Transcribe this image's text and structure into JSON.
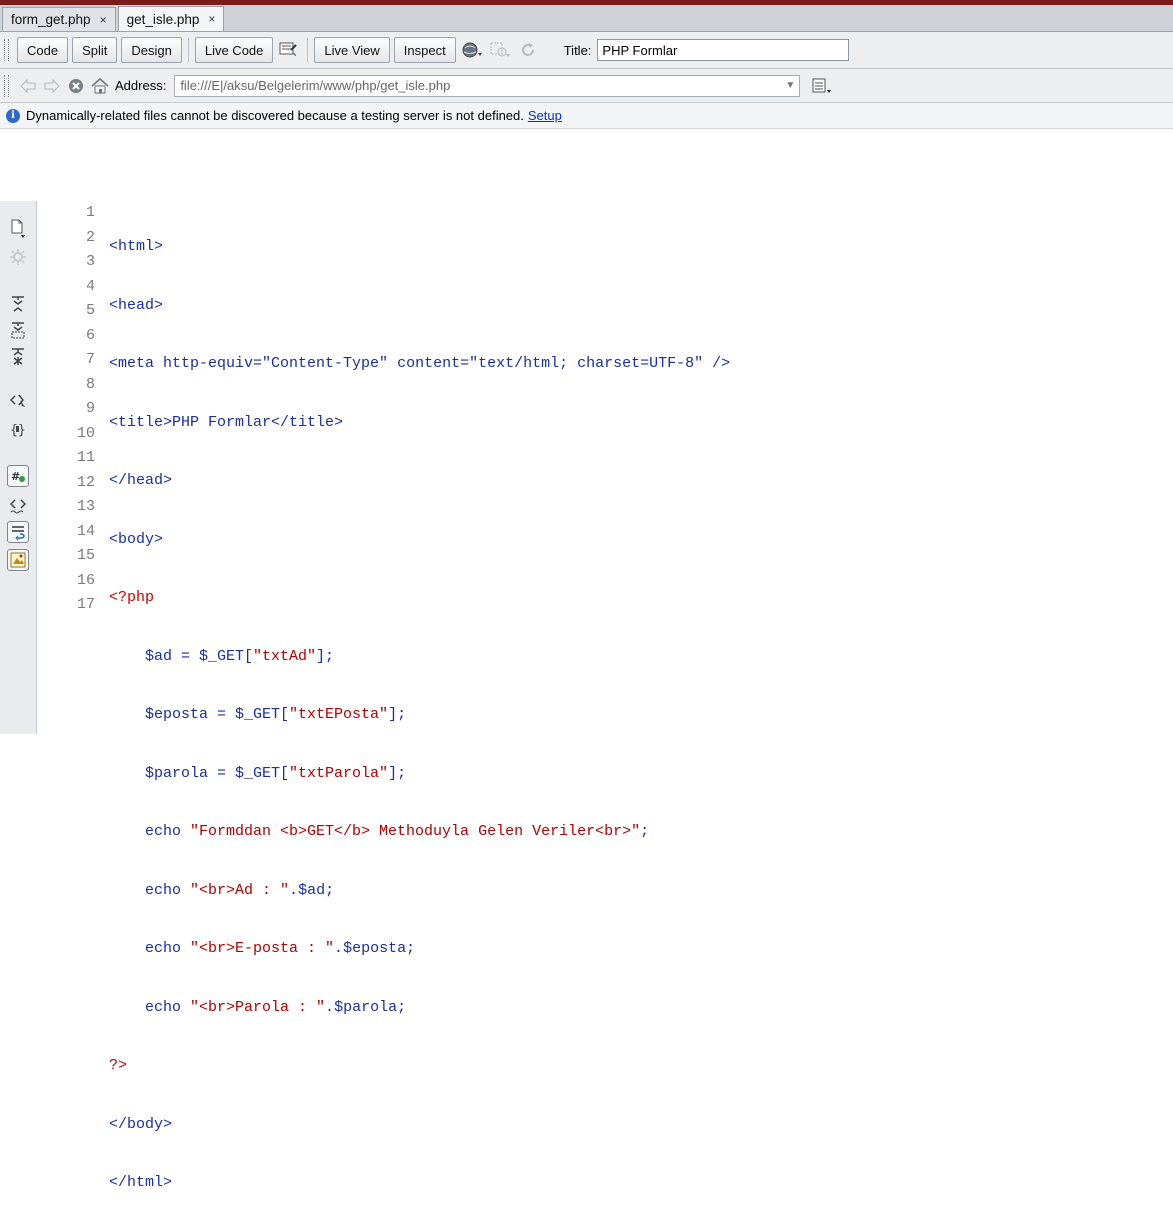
{
  "tabs": [
    {
      "label": "form_get.php",
      "close": "×"
    },
    {
      "label": "get_isle.php",
      "close": "×"
    }
  ],
  "toolbar": {
    "code_label": "Code",
    "split_label": "Split",
    "design_label": "Design",
    "live_code_label": "Live Code",
    "live_view_label": "Live View",
    "inspect_label": "Inspect",
    "title_label": "Title:",
    "title_value": "PHP Formlar"
  },
  "address": {
    "label": "Address:",
    "value": "file:///E|/aksu/Belgelerim/www/php/get_isle.php"
  },
  "infobar": {
    "message": "Dynamically-related files cannot be discovered because a testing server is not defined.",
    "link": "Setup"
  },
  "lines": {
    "n1": "1",
    "n2": "2",
    "n3": "3",
    "n4": "4",
    "n5": "5",
    "n6": "6",
    "n7": "7",
    "n8": "8",
    "n9": "9",
    "n10": "10",
    "n11": "11",
    "n12": "12",
    "n13": "13",
    "n14": "14",
    "n15": "15",
    "n16": "16",
    "n17": "17"
  },
  "code": {
    "l1": "<html>",
    "l2": "<head>",
    "l3a": "<meta http-equiv=",
    "l3b": "\"Content-Type\"",
    "l3c": " content=",
    "l3d": "\"text/html; charset=UTF-8\"",
    "l3e": " />",
    "l4": "<title>PHP Formlar</title>",
    "l5": "</head>",
    "l6": "<body>",
    "l7": "<?php",
    "l8a": "    $ad = $_GET[",
    "l8b": "\"txtAd\"",
    "l8c": "];",
    "l9a": "    $eposta = $_GET[",
    "l9b": "\"txtEPosta\"",
    "l9c": "];",
    "l10a": "    $parola = $_GET[",
    "l10b": "\"txtParola\"",
    "l10c": "];",
    "l11a": "    echo ",
    "l11b": "\"Formddan <b>GET</b> Methoduyla Gelen Veriler<br>\"",
    "l11c": ";",
    "l12a": "    echo ",
    "l12b": "\"<br>Ad : \"",
    "l12c": ".",
    "l12d": "$ad",
    "l12e": ";",
    "l13a": "    echo ",
    "l13b": "\"<br>E-posta : \"",
    "l13c": ".",
    "l13d": "$eposta",
    "l13e": ";",
    "l14a": "    echo ",
    "l14b": "\"<br>Parola : \"",
    "l14c": ".",
    "l14d": "$parola",
    "l14e": ";",
    "l15": "?>",
    "l16": "</body>",
    "l17": "</html>"
  },
  "colors": {
    "tag": "#1a2ea0",
    "php_delimiter": "#d00000",
    "php_string": "#b40000"
  }
}
